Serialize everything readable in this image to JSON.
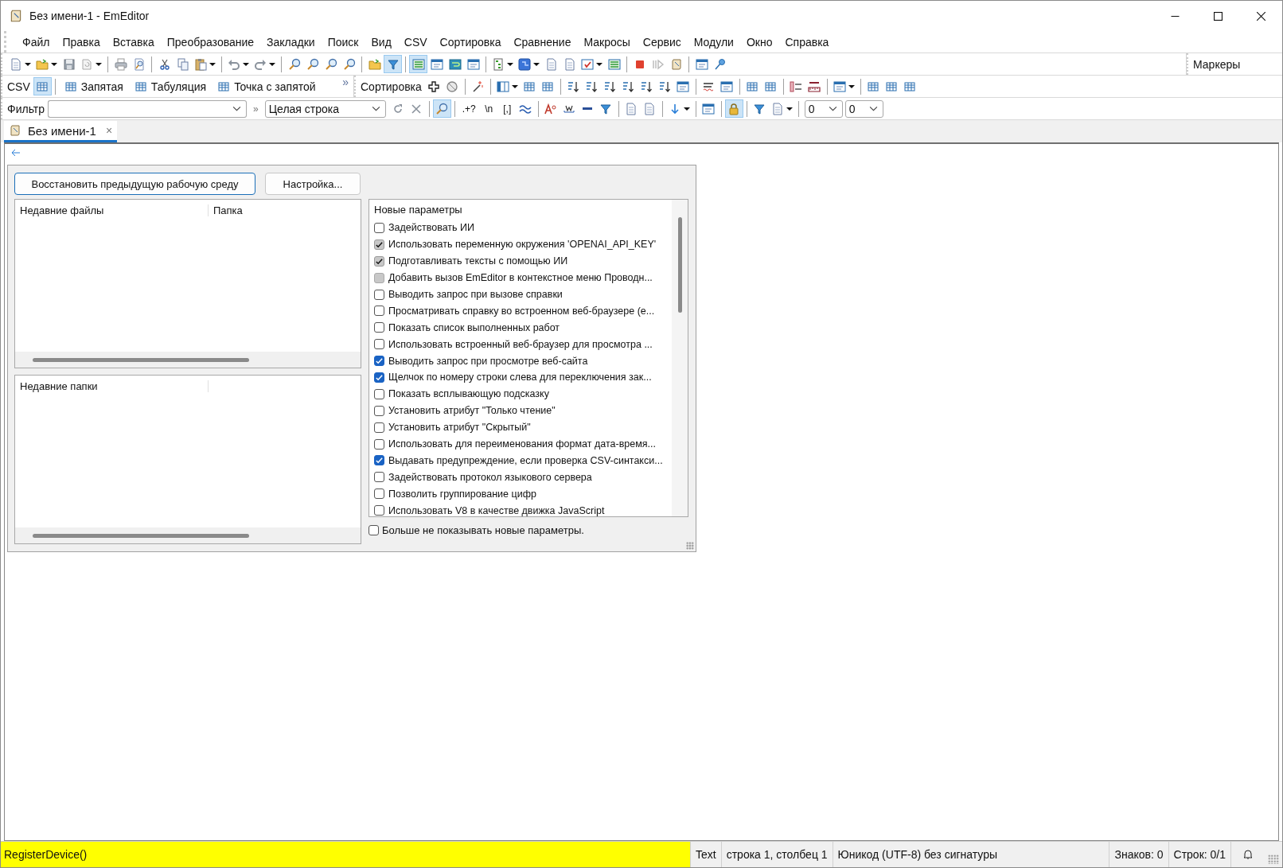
{
  "window": {
    "title": "Без имени-1 - EmEditor"
  },
  "menu": [
    "Файл",
    "Правка",
    "Вставка",
    "Преобразование",
    "Закладки",
    "Поиск",
    "Вид",
    "CSV",
    "Сортировка",
    "Сравнение",
    "Макросы",
    "Сервис",
    "Модули",
    "Окно",
    "Справка"
  ],
  "toolbar_main": {
    "buttons": [
      {
        "kind": "page",
        "dropdown": true,
        "pressed": false
      },
      {
        "kind": "folder",
        "dropdown": true,
        "pressed": false
      },
      {
        "kind": "floppy",
        "dropdown": false,
        "pressed": false
      },
      {
        "kind": "reload",
        "dropdown": true,
        "pressed": false
      },
      {
        "kind": "sep"
      },
      {
        "kind": "printer",
        "dropdown": false,
        "pressed": false
      },
      {
        "kind": "preview",
        "dropdown": false,
        "pressed": false
      },
      {
        "kind": "sep"
      },
      {
        "kind": "scissors",
        "dropdown": false,
        "pressed": false
      },
      {
        "kind": "copy",
        "dropdown": false,
        "pressed": false
      },
      {
        "kind": "clipboard",
        "dropdown": true,
        "pressed": false
      },
      {
        "kind": "sep"
      },
      {
        "kind": "undo",
        "dropdown": true,
        "pressed": false
      },
      {
        "kind": "redo",
        "dropdown": true,
        "pressed": false
      },
      {
        "kind": "sep"
      },
      {
        "kind": "magnifier",
        "dropdown": false,
        "pressed": false
      },
      {
        "kind": "magnifier",
        "dropdown": false,
        "pressed": false
      },
      {
        "kind": "magnifier",
        "dropdown": false,
        "pressed": false
      },
      {
        "kind": "magnifier",
        "dropdown": false,
        "pressed": false
      },
      {
        "kind": "sep"
      },
      {
        "kind": "folder",
        "dropdown": false,
        "pressed": false
      },
      {
        "kind": "funnel",
        "dropdown": false,
        "pressed": true
      },
      {
        "kind": "sep"
      },
      {
        "kind": "lines",
        "dropdown": false,
        "pressed": true
      },
      {
        "kind": "window",
        "dropdown": false,
        "pressed": false
      },
      {
        "kind": "wrap",
        "dropdown": false,
        "pressed": false
      },
      {
        "kind": "window",
        "dropdown": false,
        "pressed": false
      },
      {
        "kind": "sep"
      },
      {
        "kind": "tree",
        "dropdown": true,
        "pressed": false
      },
      {
        "kind": "puzzle",
        "dropdown": true,
        "pressed": false
      },
      {
        "kind": "page",
        "dropdown": false,
        "pressed": false
      },
      {
        "kind": "page",
        "dropdown": false,
        "pressed": false
      },
      {
        "kind": "check",
        "dropdown": true,
        "pressed": false
      },
      {
        "kind": "lines",
        "dropdown": false,
        "pressed": false
      },
      {
        "kind": "sep"
      },
      {
        "kind": "stop",
        "dropdown": false,
        "pressed": false
      },
      {
        "kind": "play",
        "dropdown": false,
        "pressed": false
      },
      {
        "kind": "scroll",
        "dropdown": false,
        "pressed": false
      },
      {
        "kind": "sep"
      },
      {
        "kind": "window",
        "dropdown": false,
        "pressed": false
      },
      {
        "kind": "pin",
        "dropdown": false,
        "pressed": false
      }
    ]
  },
  "markers_bar": {
    "label": "Маркеры"
  },
  "csv_bar": {
    "label": "CSV",
    "buttons": [
      {
        "kind": "grid",
        "pressed": true
      },
      {
        "kind": "sep"
      },
      {
        "kind": "grid",
        "label": "Запятая",
        "pressed": false
      },
      {
        "kind": "grid",
        "label": "Табуляция",
        "pressed": false
      },
      {
        "kind": "grid",
        "label": "Точка с запятой",
        "pressed": false
      }
    ],
    "more": "»"
  },
  "sort_bar": {
    "label": "Сортировка",
    "buttons": [
      {
        "kind": "plus",
        "dropdown": false,
        "pressed": false
      },
      {
        "kind": "circle",
        "dropdown": false,
        "pressed": false
      },
      {
        "kind": "sep"
      },
      {
        "kind": "wand",
        "dropdown": false,
        "pressed": false
      },
      {
        "kind": "sep"
      },
      {
        "kind": "columns",
        "dropdown": true,
        "pressed": false
      },
      {
        "kind": "grid",
        "dropdown": false,
        "pressed": false
      },
      {
        "kind": "grid",
        "dropdown": false,
        "pressed": false
      },
      {
        "kind": "sep"
      },
      {
        "kind": "sort",
        "dropdown": false,
        "pressed": false
      },
      {
        "kind": "sort",
        "dropdown": false,
        "pressed": false
      },
      {
        "kind": "sort",
        "dropdown": false,
        "pressed": false
      },
      {
        "kind": "sort",
        "dropdown": false,
        "pressed": false
      },
      {
        "kind": "sort",
        "dropdown": false,
        "pressed": false
      },
      {
        "kind": "sort",
        "dropdown": false,
        "pressed": false
      },
      {
        "kind": "window",
        "dropdown": false,
        "pressed": false
      },
      {
        "kind": "sep"
      },
      {
        "kind": "spell",
        "dropdown": false,
        "pressed": false
      },
      {
        "kind": "window",
        "dropdown": false,
        "pressed": false
      },
      {
        "kind": "sep"
      },
      {
        "kind": "grid",
        "dropdown": false,
        "pressed": false
      },
      {
        "kind": "grid",
        "dropdown": false,
        "pressed": false
      },
      {
        "kind": "sep"
      },
      {
        "kind": "list",
        "dropdown": false,
        "pressed": false
      },
      {
        "kind": "ruler",
        "dropdown": false,
        "pressed": false
      },
      {
        "kind": "sep"
      },
      {
        "kind": "window",
        "dropdown": true,
        "pressed": false
      },
      {
        "kind": "sep"
      },
      {
        "kind": "grid",
        "dropdown": false,
        "pressed": false
      },
      {
        "kind": "grid",
        "dropdown": false,
        "pressed": false
      },
      {
        "kind": "grid",
        "dropdown": false,
        "pressed": false
      }
    ]
  },
  "filter_bar": {
    "label": "Фильтр",
    "more": "»",
    "scope": "Целая строка",
    "buttons": [
      {
        "kind": "refresh",
        "pressed": false
      },
      {
        "kind": "close",
        "pressed": false
      },
      {
        "kind": "sep"
      },
      {
        "kind": "magnifier",
        "pressed": true
      },
      {
        "kind": "sep"
      },
      {
        "kind": "text",
        "label": ".+?",
        "pressed": false
      },
      {
        "kind": "text",
        "label": "\\n",
        "pressed": false
      },
      {
        "kind": "text",
        "label": "[,]",
        "pressed": false
      },
      {
        "kind": "wave",
        "pressed": false
      },
      {
        "kind": "sep"
      },
      {
        "kind": "letters",
        "pressed": false
      },
      {
        "kind": "word",
        "pressed": false
      },
      {
        "kind": "dash",
        "pressed": false
      },
      {
        "kind": "funnel",
        "pressed": false
      },
      {
        "kind": "sep"
      },
      {
        "kind": "page",
        "pressed": false
      },
      {
        "kind": "page",
        "pressed": false
      },
      {
        "kind": "sep"
      },
      {
        "kind": "arrowdown",
        "dropdown": true,
        "pressed": false
      },
      {
        "kind": "sep"
      },
      {
        "kind": "window",
        "pressed": false
      },
      {
        "kind": "sep"
      },
      {
        "kind": "lock",
        "pressed": true
      },
      {
        "kind": "sep"
      },
      {
        "kind": "funnel",
        "pressed": false
      },
      {
        "kind": "page",
        "dropdown": true,
        "pressed": false
      },
      {
        "kind": "sep"
      }
    ],
    "combos": [
      "0",
      "0"
    ]
  },
  "tabs": [
    {
      "label": "Без имени-1",
      "selected": true,
      "close": "×"
    }
  ],
  "dialog": {
    "buttons": [
      {
        "label": "Восстановить предыдущую рабочую среду",
        "default": true
      },
      {
        "label": "Настройка...",
        "default": false
      }
    ],
    "recent_files": {
      "columns": [
        "Недавние файлы",
        "Папка"
      ]
    },
    "recent_folders": {
      "columns": [
        "Недавние папки"
      ]
    },
    "new_options": {
      "title": "Новые параметры",
      "items": [
        {
          "label": "Задействовать ИИ",
          "checked": false,
          "disabled": false
        },
        {
          "label": "Использовать переменную окружения 'OPENAI_API_KEY'",
          "checked": true,
          "disabled": true
        },
        {
          "label": "Подготавливать тексты с помощью ИИ",
          "checked": true,
          "disabled": true
        },
        {
          "label": "Добавить вызов EmEditor в контекстное меню Проводн...",
          "checked": false,
          "disabled": true
        },
        {
          "label": "Выводить запрос при вызове справки",
          "checked": false,
          "disabled": false
        },
        {
          "label": "Просматривать справку во встроенном веб-браузере (е...",
          "checked": false,
          "disabled": false
        },
        {
          "label": "Показать список выполненных работ",
          "checked": false,
          "disabled": false
        },
        {
          "label": "Использовать встроенный веб-браузер для просмотра ...",
          "checked": false,
          "disabled": false
        },
        {
          "label": "Выводить запрос при просмотре веб-сайта",
          "checked": true,
          "disabled": false
        },
        {
          "label": "Щелчок по номеру строки слева для переключения зак...",
          "checked": true,
          "disabled": false
        },
        {
          "label": "Показать всплывающую подсказку",
          "checked": false,
          "disabled": false
        },
        {
          "label": "Установить атрибут \"Только чтение\"",
          "checked": false,
          "disabled": false
        },
        {
          "label": "Установить атрибут \"Скрытый\"",
          "checked": false,
          "disabled": false
        },
        {
          "label": "Использовать для переименования формат дата-время...",
          "checked": false,
          "disabled": false
        },
        {
          "label": "Выдавать предупреждение, если проверка CSV-синтакси...",
          "checked": true,
          "disabled": false
        },
        {
          "label": "Задействовать протокол языкового сервера",
          "checked": false,
          "disabled": false
        },
        {
          "label": "Позволить группирование цифр",
          "checked": false,
          "disabled": false
        },
        {
          "label": "Использовать V8 в качестве движка JavaScript",
          "checked": false,
          "disabled": false
        }
      ]
    },
    "dont_show": {
      "label": "Больше не показывать новые параметры.",
      "checked": false
    }
  },
  "status_bar": {
    "message": "RegisterDevice()",
    "mode": "Text",
    "position": "строка 1, столбец 1",
    "encoding": "Юникод (UTF-8) без сигнатуры",
    "chars": "Знаков: 0",
    "lines": "Строк: 0/1"
  }
}
